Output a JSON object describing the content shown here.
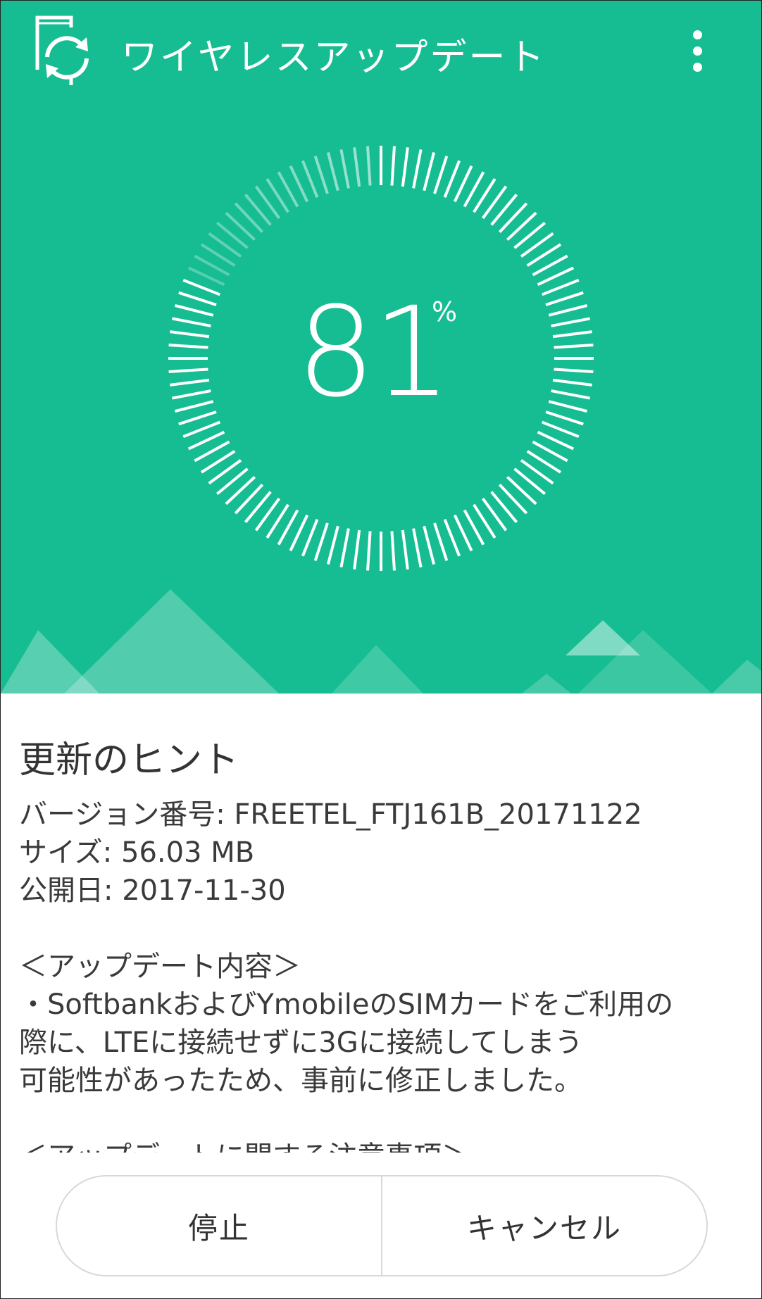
{
  "header": {
    "title": "ワイヤレスアップデート",
    "more_menu_icon": "more-vert-icon",
    "app_icon": "phone-sync-icon"
  },
  "progress": {
    "value": 81,
    "number_text": "81",
    "unit": "%"
  },
  "info": {
    "title": "更新のヒント",
    "lines": [
      "バージョン番号: FREETEL_FTJ161B_20171122",
      "サイズ: 56.03 MB",
      "公開日: 2017-11-30",
      "",
      "＜アップデート内容＞",
      "・SoftbankおよびYmobileのSIMカードをご利用の",
      "際に、LTEに接続せずに3Gに接続してしまう",
      "可能性があったため、事前に修正しました。",
      "",
      "＜アップデートに関する注意事項＞"
    ]
  },
  "buttons": {
    "stop": "停止",
    "cancel": "キャンセル"
  },
  "colors": {
    "accent": "#17bd92",
    "text": "#333333",
    "button_border": "#d8d8d8"
  }
}
